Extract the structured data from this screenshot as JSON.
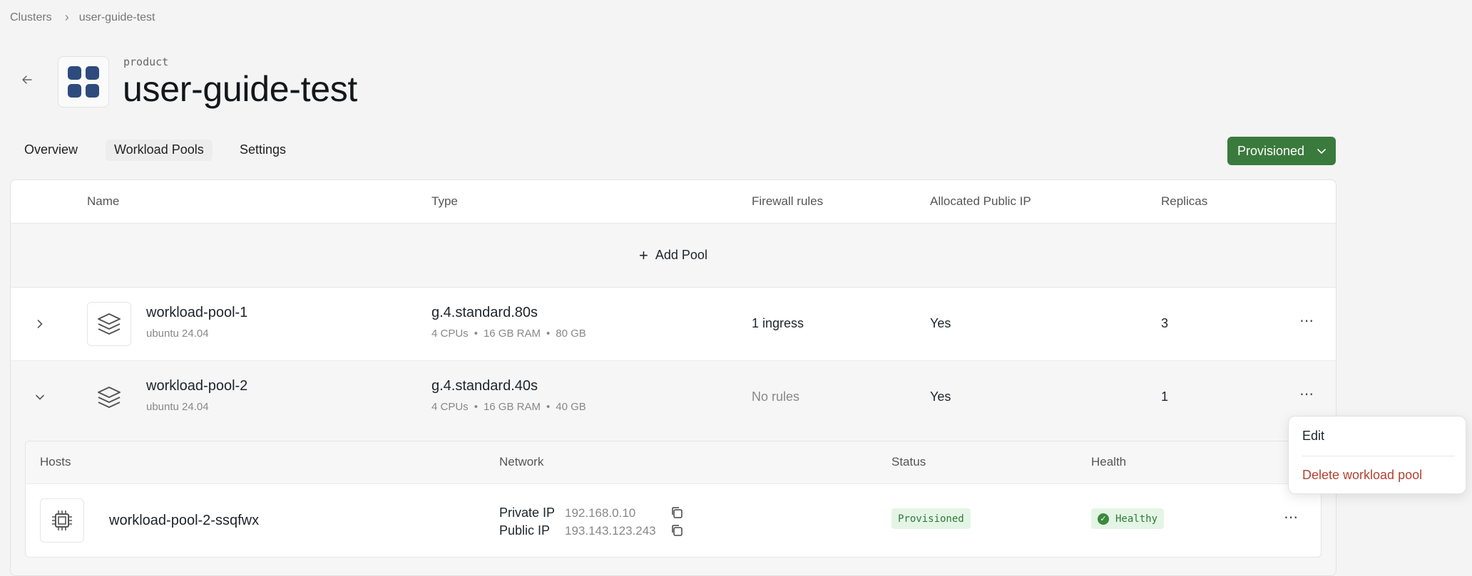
{
  "breadcrumb": {
    "root": "Clusters",
    "current": "user-guide-test"
  },
  "header": {
    "kicker": "product",
    "title": "user-guide-test"
  },
  "tabs": [
    {
      "label": "Overview"
    },
    {
      "label": "Workload Pools"
    },
    {
      "label": "Settings"
    }
  ],
  "status_button": {
    "label": "Provisioned"
  },
  "table": {
    "columns": [
      "Name",
      "Type",
      "Firewall rules",
      "Allocated Public IP",
      "Replicas"
    ],
    "add_label": "Add Pool",
    "rows": [
      {
        "name": "workload-pool-1",
        "os": "ubuntu 24.04",
        "type": "g.4.standard.80s",
        "cpus": "4 CPUs",
        "ram": "16 GB RAM",
        "disk": "80 GB",
        "firewall": "1 ingress",
        "public_ip": "Yes",
        "replicas": "3",
        "expanded": false
      },
      {
        "name": "workload-pool-2",
        "os": "ubuntu 24.04",
        "type": "g.4.standard.40s",
        "cpus": "4 CPUs",
        "ram": "16 GB RAM",
        "disk": "40 GB",
        "firewall": "No rules",
        "public_ip": "Yes",
        "replicas": "1",
        "expanded": true
      }
    ]
  },
  "hosts": {
    "columns": [
      "Hosts",
      "Network",
      "Status",
      "Health"
    ],
    "rows": [
      {
        "name": "workload-pool-2-ssqfwx",
        "private_label": "Private IP",
        "private_ip": "192.168.0.10",
        "public_label": "Public IP",
        "public_ip": "193.143.123.243",
        "status": "Provisioned",
        "health": "Healthy"
      }
    ]
  },
  "menu": {
    "edit": "Edit",
    "delete": "Delete workload pool",
    "delete_color": "#b5412f"
  },
  "colors": {
    "accent": "#3a7a3c",
    "brand": "#2e4b7e",
    "healthy_bg": "#e4f5e6"
  },
  "icons": {
    "back": "arrow-left-icon",
    "pool": "layers-icon",
    "host": "cpu-chip-icon",
    "copy": "copy-icon",
    "more": "more-horizontal-icon"
  }
}
